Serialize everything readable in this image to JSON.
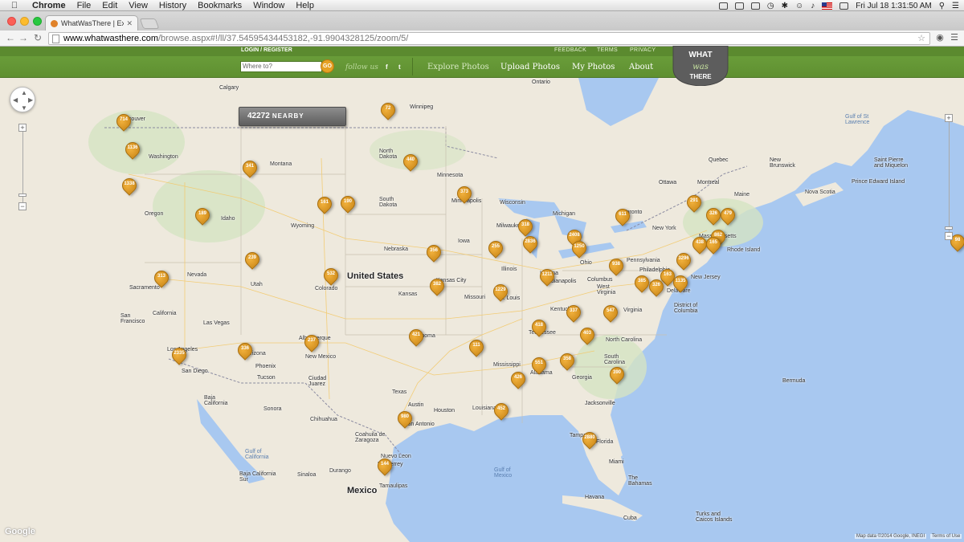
{
  "menubar": {
    "items": [
      "Chrome",
      "File",
      "Edit",
      "View",
      "History",
      "Bookmarks",
      "Window",
      "Help"
    ],
    "clock": "Fri Jul 18  1:31:50 AM"
  },
  "browser": {
    "tab_title": "WhatWasThere | Explore P",
    "url_host": "www.whatwasthere.com",
    "url_path": "/browse.aspx#!/ll/37.54595434453182,-91.9904328125/zoom/5/"
  },
  "site": {
    "login_label": "LOGIN / REGISTER",
    "search_placeholder": "Where to?",
    "go_label": "GO",
    "follow_label": "follow us",
    "social": [
      "f",
      "t"
    ],
    "top_links": [
      "FEEDBACK",
      "TERMS",
      "PRIVACY"
    ],
    "nav": [
      "Explore Photos",
      "Upload Photos",
      "My Photos",
      "About"
    ],
    "logo": {
      "line1": "WHAT",
      "line2": "was",
      "line3": "THERE"
    }
  },
  "map": {
    "nearby_count": "42272",
    "nearby_label": "NEARBY",
    "country_label": "United States",
    "mexico_label": "Mexico",
    "attribution": "Map data ©2014 Google, INEGI",
    "terms": "Terms of Use",
    "google": "Google",
    "labels": [
      "Calgary",
      "Winnipeg",
      "Ontario",
      "Vancouver",
      "Washington",
      "Montana",
      "North Dakota",
      "Minnesota",
      "Oregon",
      "Idaho",
      "South Dakota",
      "Wyoming",
      "Wisconsin",
      "Minneapolis",
      "Michigan",
      "Quebec",
      "Nebraska",
      "Iowa",
      "Milwaukee",
      "Toronto",
      "Ottawa",
      "Montreal",
      "Maine",
      "New Brunswick",
      "Nevada",
      "Utah",
      "Colorado",
      "Kansas",
      "Kansas City",
      "Missouri",
      "St. Louis",
      "Illinois",
      "Ohio",
      "Indiana",
      "Indianapolis",
      "Pennsylvania",
      "New York",
      "Massachusetts",
      "Rhode Island",
      "Philadelphia",
      "New Jersey",
      "Delaware",
      "Columbus",
      "West Virginia",
      "Sacramento",
      "San Francisco",
      "California",
      "Las Vegas",
      "Los Angeles",
      "San Diego",
      "Arizona",
      "Phoenix",
      "Tucson",
      "Albuquerque",
      "New Mexico",
      "Oklahoma",
      "Kentucky",
      "Tennessee",
      "Virginia",
      "District of Columbia",
      "North Carolina",
      "South Carolina",
      "Georgia",
      "Alabama",
      "Mississippi",
      "Louisiana",
      "Texas",
      "Austin",
      "Houston",
      "San Antonio",
      "Jacksonville",
      "Florida",
      "Tampa",
      "Miami",
      "Baja California",
      "Sonora",
      "Chihuahua",
      "Ciudad Juarez",
      "Coahuila de Zaragoza",
      "Nuevo Leon",
      "Monterrey",
      "Tamaulipas",
      "Sinaloa",
      "Durango",
      "Baja California Sur",
      "Gulf of California",
      "Gulf of Mexico",
      "Gulf of St Lawrence",
      "Nova Scotia",
      "Prince Edward Island",
      "Saint Pierre and Miquelon",
      "Bermuda",
      "The Bahamas",
      "Cuba",
      "Havana",
      "Turks and Caicos Islands",
      "San Luis Potosi",
      "Veracruz",
      "Nayarit",
      "Yucatan",
      "Hampshire",
      "Vermont",
      "Pennsylvania",
      "Kentucky",
      "Detroit",
      "Chicago"
    ],
    "pins": [
      "714",
      "1136",
      "341",
      "1338",
      "189",
      "72",
      "440",
      "373",
      "161",
      "190",
      "239",
      "532",
      "313",
      "356",
      "255",
      "318",
      "2836",
      "611",
      "2408",
      "1250",
      "3296",
      "291",
      "326",
      "479",
      "438",
      "862",
      "165",
      "1211",
      "938",
      "1229",
      "382",
      "421",
      "337",
      "547",
      "163",
      "385",
      "326",
      "1135",
      "418",
      "403",
      "358",
      "551",
      "426",
      "390",
      "2880",
      "452",
      "980",
      "144",
      "111",
      "2335",
      "336",
      "237",
      "98"
    ]
  }
}
